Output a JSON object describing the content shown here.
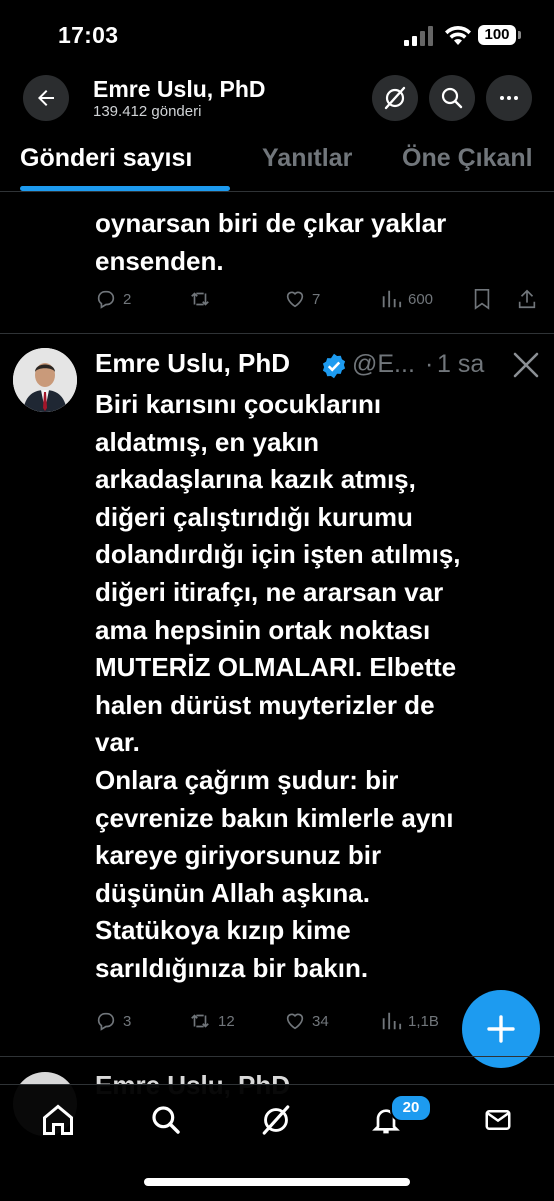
{
  "status_bar": {
    "time": "17:03",
    "battery": "100"
  },
  "header": {
    "name": "Emre Uslu, PhD",
    "post_count": "139.412 gönderi"
  },
  "tabs": [
    {
      "label": "Gönderi sayısı"
    },
    {
      "label": "Yanıtlar"
    },
    {
      "label": "Öne Çıkanl"
    }
  ],
  "prev_tweet": {
    "text_lines": [
      "oynarsan biri de çıkar yaklar",
      "ensenden."
    ],
    "replies": "2",
    "reposts": "",
    "likes": "7",
    "views": "600"
  },
  "tweet": {
    "name": "Emre Uslu, PhD",
    "handle": "@E...",
    "time": "1 sa",
    "text_lines": [
      "Biri karısını çocuklarını",
      "aldatmış, en yakın",
      "arkadaşlarına kazık atmış,",
      "diğeri çalıştırıdığı kurumu",
      "dolandırdığı için işten atılmış,",
      "diğeri itirafçı, ne ararsan var",
      "ama hepsinin ortak noktası",
      "MUTERİZ OLMALARI. Elbette",
      "halen dürüst muyterizler de",
      "var.",
      "Onlara çağrım şudur: bir",
      "çevrenize bakın kimlerle aynı",
      "kareye giriyorsunuz bir",
      "düşünün Allah aşkına.",
      "Statükoya kızıp kime",
      "sarıldığınıza bir bakın."
    ],
    "replies": "3",
    "reposts": "12",
    "likes": "34",
    "views": "1,1B"
  },
  "next_tweet": {
    "name": "Emre Uslu, PhD"
  },
  "bottom_nav": {
    "notifications_badge": "20"
  },
  "colors": {
    "accent": "#1d9bf0",
    "muted": "#71767b",
    "background": "#000000"
  }
}
